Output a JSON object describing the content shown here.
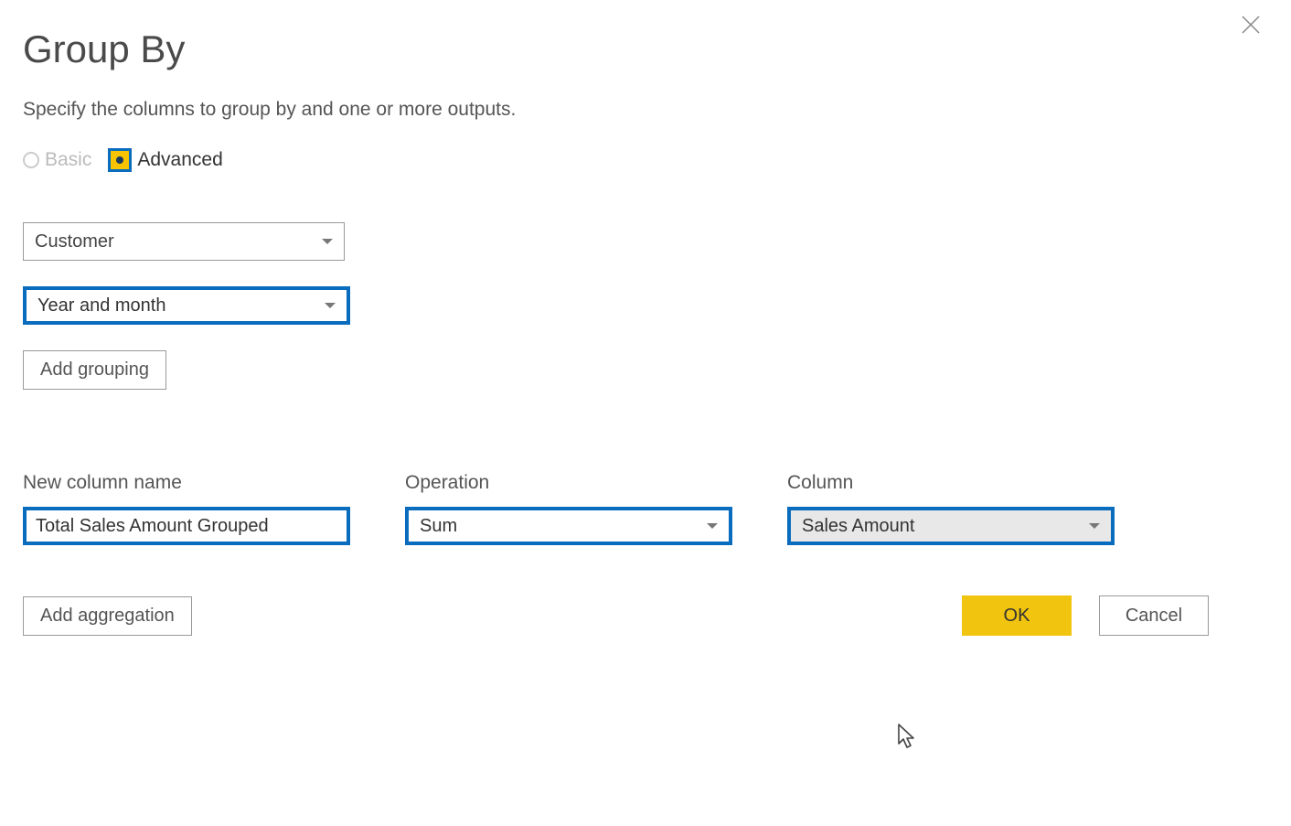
{
  "dialog": {
    "title": "Group By",
    "subtitle": "Specify the columns to group by and one or more outputs."
  },
  "mode": {
    "basic_label": "Basic",
    "advanced_label": "Advanced",
    "selected": "advanced"
  },
  "groupings": {
    "items": [
      {
        "value": "Customer",
        "highlighted": false
      },
      {
        "value": "Year and month",
        "highlighted": true
      }
    ],
    "add_button_label": "Add grouping"
  },
  "aggregations": {
    "header_new_column": "New column name",
    "header_operation": "Operation",
    "header_column": "Column",
    "rows": [
      {
        "new_column_name": "Total Sales Amount Grouped",
        "operation": "Sum",
        "column": "Sales Amount"
      }
    ],
    "add_button_label": "Add aggregation"
  },
  "footer": {
    "ok_label": "OK",
    "cancel_label": "Cancel"
  }
}
